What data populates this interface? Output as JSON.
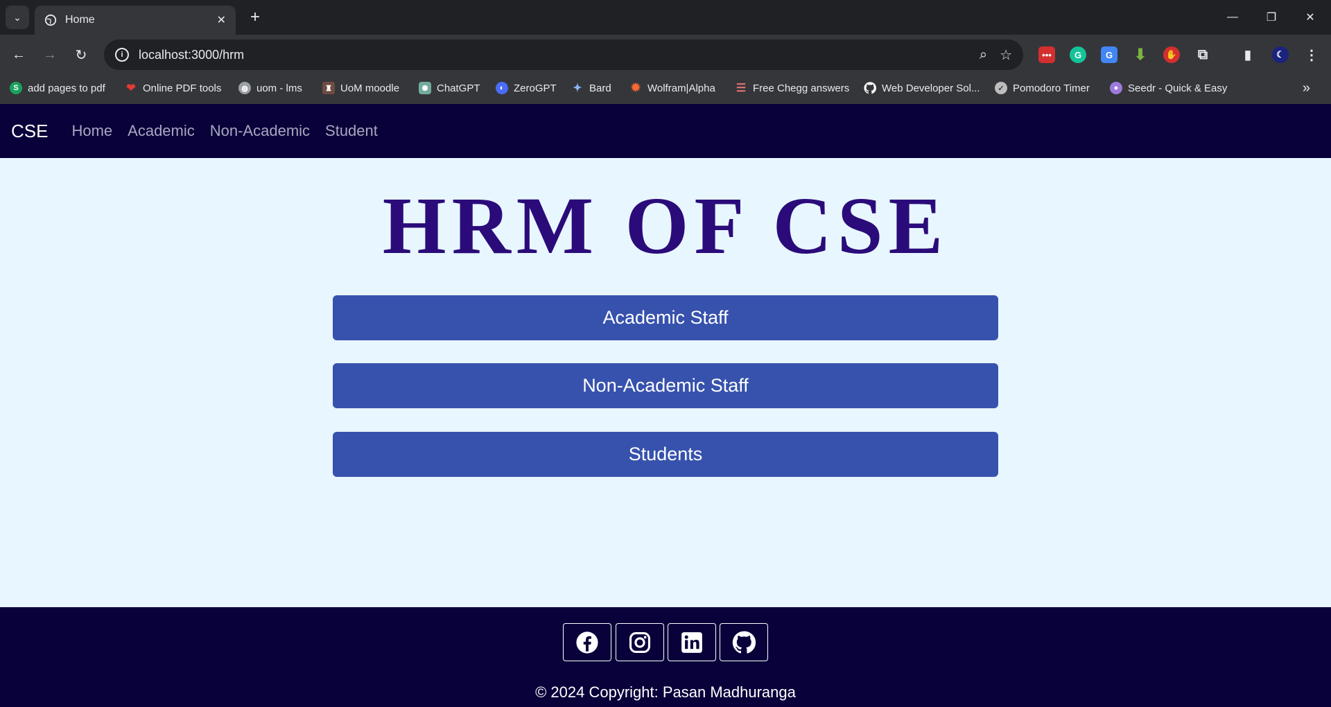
{
  "browser": {
    "tab_title": "Home",
    "url": "localhost:3000/hrm",
    "bookmarks": [
      {
        "label": "add pages to pdf",
        "icon": "s-logo-icon",
        "color": "#1aa260"
      },
      {
        "label": "Online PDF tools",
        "icon": "heart-icon",
        "color": "#e53935"
      },
      {
        "label": "uom - lms",
        "icon": "globe-icon",
        "color": "#9aa0a6"
      },
      {
        "label": "UoM moodle",
        "icon": "crest-icon",
        "color": "#8d6e63"
      },
      {
        "label": "ChatGPT",
        "icon": "chatgpt-icon",
        "color": "#74aa9c"
      },
      {
        "label": "ZeroGPT",
        "icon": "zerogpt-icon",
        "color": "#4a6cf7"
      },
      {
        "label": "Bard",
        "icon": "sparkle-icon",
        "color": "#8ab4f8"
      },
      {
        "label": "Wolfram|Alpha",
        "icon": "wolfram-icon",
        "color": "#f96932"
      },
      {
        "label": "Free Chegg answers",
        "icon": "stack-icon",
        "color": "#e57373"
      },
      {
        "label": "Web Developer Sol...",
        "icon": "github-icon",
        "color": "#ffffff"
      },
      {
        "label": "Pomodoro Timer",
        "icon": "check-circle-icon",
        "color": "#bdbdbd"
      },
      {
        "label": "Seedr - Quick & Easy",
        "icon": "seed-icon",
        "color": "#9c7bdc"
      }
    ]
  },
  "navbar": {
    "brand": "CSE",
    "links": [
      "Home",
      "Academic",
      "Non-Academic",
      "Student"
    ]
  },
  "main": {
    "title": "HRM OF CSE",
    "buttons": [
      "Academic Staff",
      "Non-Academic Staff",
      "Students"
    ]
  },
  "footer": {
    "social_icons": [
      "facebook-icon",
      "instagram-icon",
      "linkedin-icon",
      "github-icon"
    ],
    "copyright": "© 2024 Copyright: Pasan Madhuranga"
  },
  "colors": {
    "navbar_bg": "#08013a",
    "page_bg": "#e8f6ff",
    "title": "#2b0b7a",
    "button_bg": "#3752ad"
  }
}
